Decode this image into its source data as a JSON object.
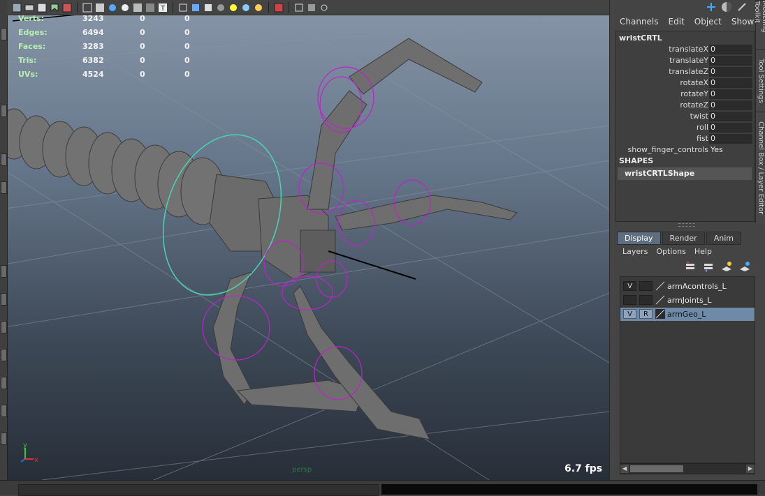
{
  "viewport": {
    "hud": [
      {
        "label": "Verts:",
        "v1": "3243",
        "v2": "0",
        "v3": "0"
      },
      {
        "label": "Edges:",
        "v1": "6494",
        "v2": "0",
        "v3": "0"
      },
      {
        "label": "Faces:",
        "v1": "3283",
        "v2": "0",
        "v3": "0"
      },
      {
        "label": "Tris:",
        "v1": "6382",
        "v2": "0",
        "v3": "0"
      },
      {
        "label": "UVs:",
        "v1": "4524",
        "v2": "0",
        "v3": "0"
      }
    ],
    "fps": "6.7 fps",
    "camera_label": "persp",
    "axis": {
      "y": "y",
      "x": "x",
      "z": "z"
    },
    "colors": {
      "selection": "#c21fd1",
      "wrist_control": "#48d6b0",
      "mesh": "#6e6e6e"
    }
  },
  "channel_box": {
    "menu": [
      "Channels",
      "Edit",
      "Object",
      "Show"
    ],
    "object_name": "wristCRTL",
    "attributes": [
      {
        "name": "translateX",
        "value": "0"
      },
      {
        "name": "translateY",
        "value": "0"
      },
      {
        "name": "translateZ",
        "value": "0"
      },
      {
        "name": "rotateX",
        "value": "0"
      },
      {
        "name": "rotateY",
        "value": "0"
      },
      {
        "name": "rotateZ",
        "value": "0"
      },
      {
        "name": "twist",
        "value": "0"
      },
      {
        "name": "roll",
        "value": "0"
      },
      {
        "name": "fist",
        "value": "0"
      },
      {
        "name": "show_finger_controls",
        "value": "Yes"
      }
    ],
    "shapes_header": "SHAPES",
    "shape_name": "wristCRTLShape"
  },
  "side_tabs": [
    "Modeling Toolkit",
    "Tool Settings",
    "Channel Box / Layer Editor"
  ],
  "layer_editor": {
    "tabs": [
      "Display",
      "Render",
      "Anim"
    ],
    "active_tab": "Display",
    "menu": [
      "Layers",
      "Options",
      "Help"
    ],
    "layers": [
      {
        "name": "armAcontrols_L",
        "v": "V",
        "r": "",
        "selected": false
      },
      {
        "name": "armJoints_L",
        "v": "",
        "r": "",
        "selected": false
      },
      {
        "name": "armGeo_L",
        "v": "V",
        "r": "R",
        "selected": true
      }
    ]
  }
}
